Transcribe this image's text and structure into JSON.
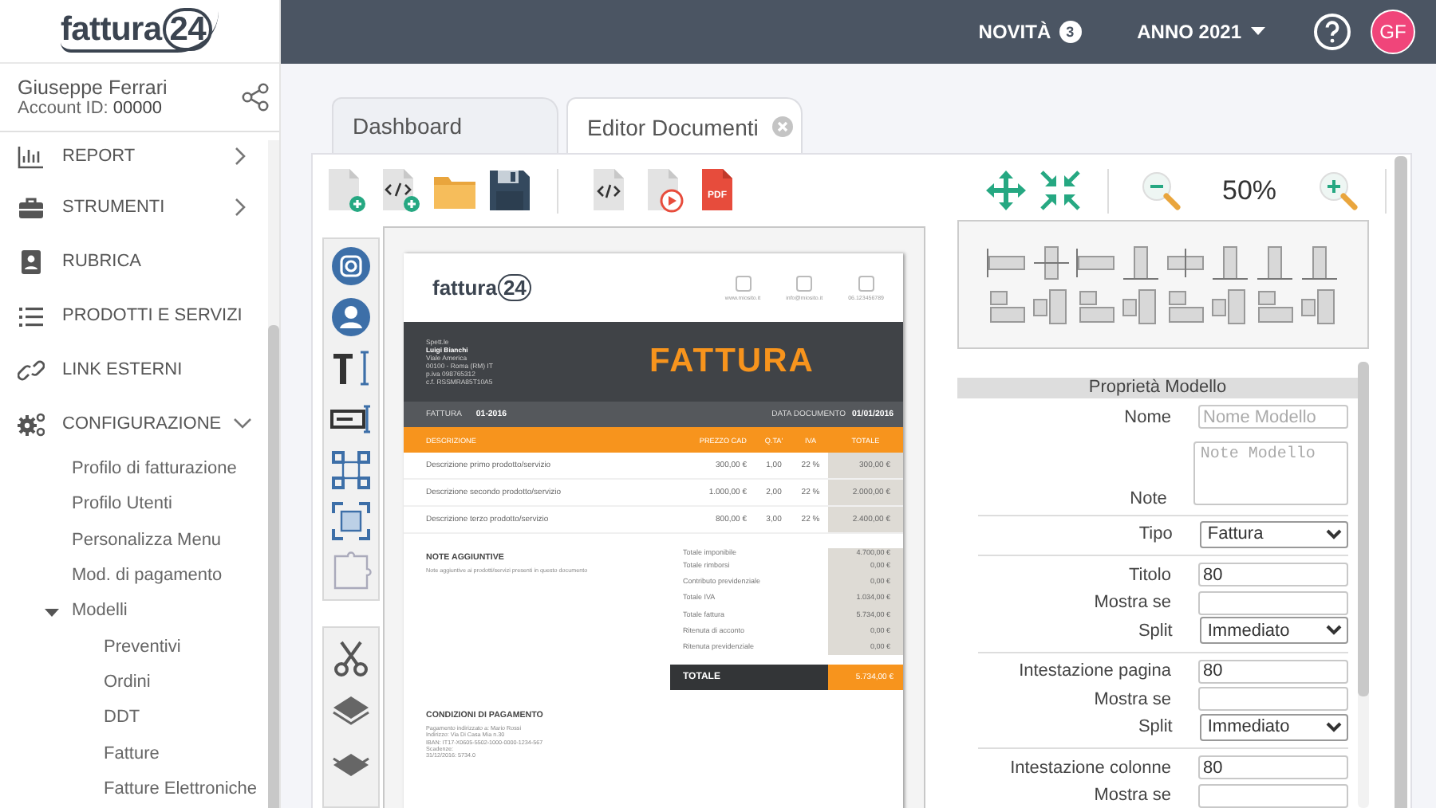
{
  "logo": {
    "name": "fattura",
    "number": "24"
  },
  "user": {
    "name": "Giuseppe Ferrari",
    "account_label": "Account ID:",
    "account_id": "00000"
  },
  "nav": [
    {
      "label": "REPORT",
      "kind": "group",
      "expanded": false
    },
    {
      "label": "STRUMENTI",
      "kind": "group",
      "expanded": false
    },
    {
      "label": "RUBRICA",
      "kind": "link"
    },
    {
      "label": "PRODOTTI E SERVIZI",
      "kind": "link"
    },
    {
      "label": "LINK ESTERNI",
      "kind": "link"
    },
    {
      "label": "CONFIGURAZIONE",
      "kind": "group",
      "expanded": true,
      "children": [
        {
          "label": "Profilo di fatturazione"
        },
        {
          "label": "Profilo Utenti"
        },
        {
          "label": "Personalizza Menu"
        },
        {
          "label": "Mod. di pagamento"
        },
        {
          "label": "Modelli",
          "expanded": true,
          "children": [
            {
              "label": "Preventivi"
            },
            {
              "label": "Ordini"
            },
            {
              "label": "DDT"
            },
            {
              "label": "Fatture"
            },
            {
              "label": "Fatture Elettroniche"
            }
          ]
        }
      ]
    }
  ],
  "topbar": {
    "news_label": "NOVITÀ",
    "news_count": "3",
    "year": "ANNO 2021",
    "avatar": "GF"
  },
  "tabs": [
    {
      "label": "Dashboard",
      "selected": false,
      "closable": false
    },
    {
      "label": "Editor Documenti",
      "selected": true,
      "closable": true
    }
  ],
  "toolbar": {
    "pdf_label": "PDF",
    "zoom": "50%"
  },
  "document": {
    "logo_name": "fattura",
    "logo_number": "24",
    "contacts": [
      "www.miosito.it",
      "info@miosito.it",
      "06.123456789"
    ],
    "client_lines": [
      {
        "text": "Spett.le",
        "bold": false
      },
      {
        "text": "Luigi Bianchi",
        "bold": true
      },
      {
        "text": "Viale America",
        "bold": false
      },
      {
        "text": "00100 - Roma (RM) IT",
        "bold": false
      },
      {
        "text": "p.iva 098765312",
        "bold": false
      },
      {
        "text": "c.f. RSSMRA85T10A5",
        "bold": false
      }
    ],
    "title": "FATTURA",
    "number_label": "FATTURA",
    "number": "01-2016",
    "date_label": "DATA DOCUMENTO",
    "date": "01/01/2016",
    "columns": [
      "DESCRIZIONE",
      "PREZZO CAD",
      "Q.TA'",
      "IVA",
      "TOTALE"
    ],
    "rows": [
      [
        "Descrizione primo prodotto/servizio",
        "300,00 €",
        "1,00",
        "22 %",
        "300,00 €"
      ],
      [
        "Descrizione secondo prodotto/servizio",
        "1.000,00 €",
        "2,00",
        "22 %",
        "2.000,00 €"
      ],
      [
        "Descrizione terzo prodotto/servizio",
        "800,00 €",
        "3,00",
        "22 %",
        "2.400,00 €"
      ]
    ],
    "notes_title": "NOTE AGGIUNTIVE",
    "notes_text": "Note aggiuntive ai prodotti/servizi presenti in questo documento",
    "totals": [
      [
        "Totale imponibile",
        "4.700,00 €"
      ],
      [
        "Totale rimborsi",
        "0,00 €"
      ],
      [
        "Contributo previdenziale",
        "0,00 €"
      ],
      [
        "Totale IVA",
        "1.034,00 €"
      ],
      [
        "Totale fattura",
        "5.734,00 €"
      ],
      [
        "Ritenuta di acconto",
        "0,00 €"
      ],
      [
        "Ritenuta previdenziale",
        "0,00 €"
      ]
    ],
    "total_label": "TOTALE",
    "total": "5.734,00 €",
    "payment_title": "CONDIZIONI DI PAGAMENTO",
    "payment_lines": [
      "Pagamento indirizzato a: Mario Rossi",
      "Indirizzo: Via Di Casa Mia n.30",
      "IBAN: IT17-X0605-5502-1000-0000-1234-567",
      "Scadenze:",
      "31/12/2016: 5734.0"
    ]
  },
  "properties": {
    "title": "Proprietà Modello",
    "sections": [
      [
        {
          "kind": "text",
          "label": "Nome",
          "placeholder": "Nome Modello"
        },
        {
          "kind": "textarea",
          "label": "Note",
          "placeholder": "Note Modello"
        }
      ],
      [
        {
          "kind": "select",
          "label": "Tipo",
          "value": "Fattura"
        }
      ],
      [
        {
          "kind": "text",
          "label": "Titolo",
          "value": "80"
        },
        {
          "kind": "text",
          "label": "Mostra se"
        },
        {
          "kind": "select",
          "label": "Split",
          "value": "Immediato"
        }
      ],
      [
        {
          "kind": "text",
          "label": "Intestazione pagina",
          "value": "80"
        },
        {
          "kind": "text",
          "label": "Mostra se"
        },
        {
          "kind": "select",
          "label": "Split",
          "value": "Immediato"
        }
      ],
      [
        {
          "kind": "text",
          "label": "Intestazione colonne",
          "value": "80"
        },
        {
          "kind": "text",
          "label": "Mostra se"
        }
      ]
    ]
  }
}
